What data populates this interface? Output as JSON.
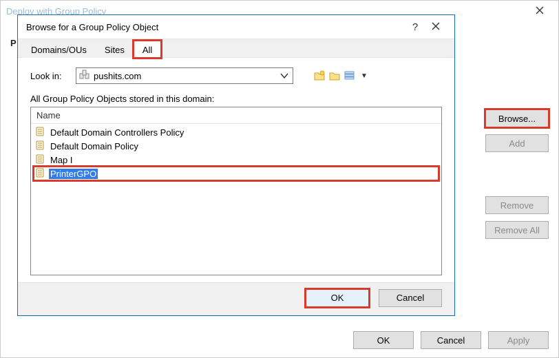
{
  "outer": {
    "title": "Deploy with Group Policy",
    "close_glyph": "✕",
    "ok_label": "OK",
    "cancel_label": "Cancel",
    "apply_label": "Apply",
    "left_fragment_label": "P"
  },
  "sidebar": {
    "browse": "Browse...",
    "add": "Add",
    "remove": "Remove",
    "remove_all": "Remove All"
  },
  "browse": {
    "title": "Browse for a Group Policy Object",
    "help_glyph": "?",
    "tabs": {
      "domains": "Domains/OUs",
      "sites": "Sites",
      "all": "All"
    },
    "lookin_label": "Look in:",
    "lookin_value": "pushits.com",
    "list_label": "All Group Policy Objects stored in this domain:",
    "columns": {
      "name": "Name"
    },
    "items": [
      {
        "label": "Default Domain Controllers Policy",
        "selected": false
      },
      {
        "label": "Default Domain Policy",
        "selected": false
      },
      {
        "label": "Map I",
        "selected": false
      },
      {
        "label": "PrinterGPO",
        "selected": true
      }
    ],
    "ok_label": "OK",
    "cancel_label": "Cancel"
  },
  "icons": {
    "domain": "domain-icon",
    "scroll": "gpo-scroll-icon",
    "folder_up": "new-folder-icon",
    "folder": "folder-icon",
    "details": "details-view-icon",
    "dropdown": "chevron-down-icon"
  }
}
